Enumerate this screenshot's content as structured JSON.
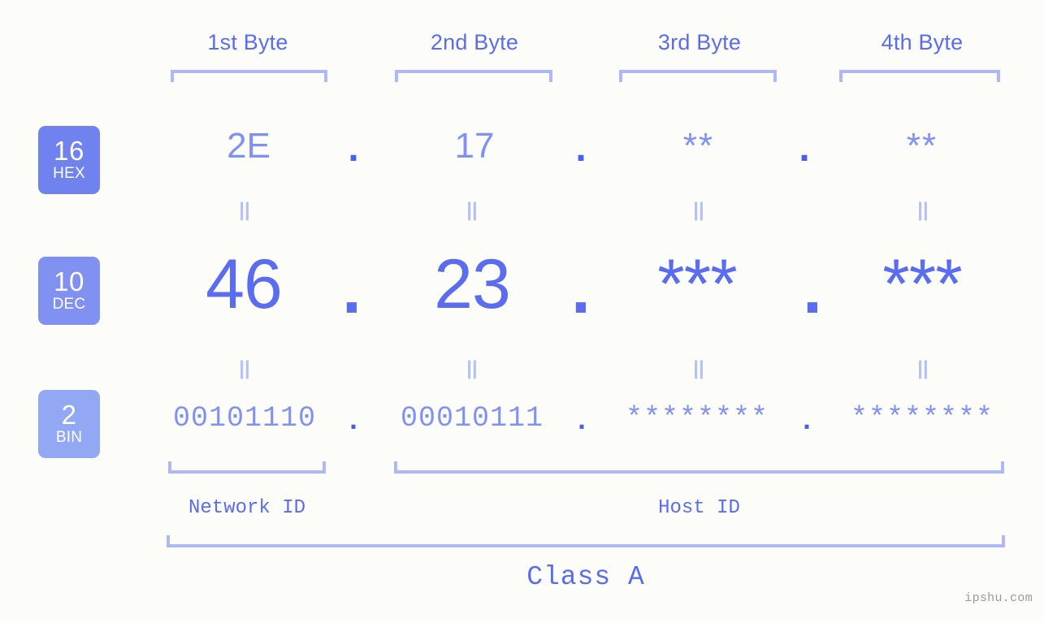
{
  "background_color": "#fcfdf9",
  "accent_colors": {
    "bracket": "#aeb8f7",
    "hex_badge": "#7082ee",
    "dec_badge": "#8191f2",
    "bin_badge": "#93a8f5",
    "hex_text": "#8191f2",
    "dec_text": "#5a6cf0",
    "bin_text": "#8191f2",
    "dot": "#4a5fe8",
    "label": "#5a6cf0",
    "equals": "#b6c0f8",
    "watermark": "#9a9a9a"
  },
  "header": {
    "byte_labels": [
      "1st Byte",
      "2nd Byte",
      "3rd Byte",
      "4th Byte"
    ]
  },
  "bases": [
    {
      "number": "16",
      "name": "HEX"
    },
    {
      "number": "10",
      "name": "DEC"
    },
    {
      "number": "2",
      "name": "BIN"
    }
  ],
  "rows": {
    "hex": {
      "base_number": "16",
      "base_name": "HEX",
      "values": [
        "2E",
        "17",
        "**",
        "**"
      ],
      "separator": "."
    },
    "dec": {
      "base_number": "10",
      "base_name": "DEC",
      "values": [
        "46",
        "23",
        "***",
        "***"
      ],
      "separator": "."
    },
    "bin": {
      "base_number": "2",
      "base_name": "BIN",
      "values": [
        "00101110",
        "00010111",
        "********",
        "********"
      ],
      "separator": "."
    }
  },
  "connectors": {
    "equals_symbol": "||"
  },
  "footer": {
    "network_id_label": "Network ID",
    "host_id_label": "Host ID",
    "class_label": "Class A"
  },
  "watermark": "ipshu.com"
}
